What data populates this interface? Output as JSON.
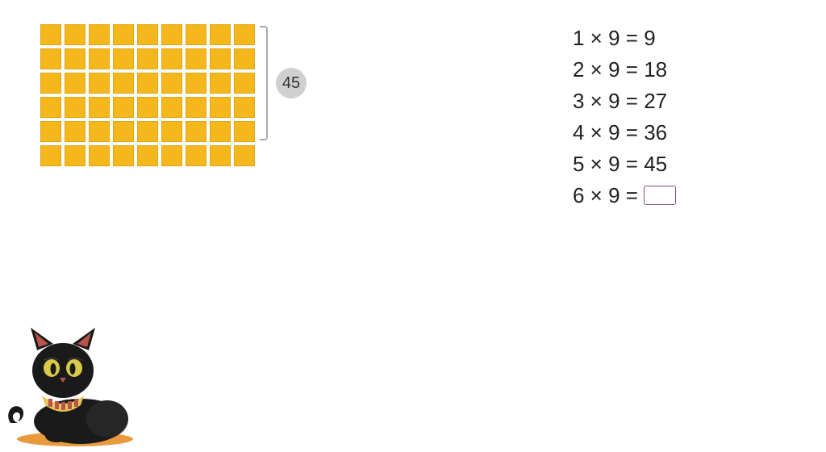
{
  "grid": {
    "rows": 6,
    "cols": 9
  },
  "badge_value": "45",
  "equations": [
    {
      "lhs": "1 × 9 =",
      "rhs": "9",
      "input": false
    },
    {
      "lhs": "2 × 9 =",
      "rhs": "18",
      "input": false
    },
    {
      "lhs": "3 × 9 =",
      "rhs": "27",
      "input": false
    },
    {
      "lhs": "4 × 9 =",
      "rhs": "36",
      "input": false
    },
    {
      "lhs": "5 × 9 =",
      "rhs": "45",
      "input": false
    },
    {
      "lhs": "6 × 9 =",
      "rhs": "",
      "input": true
    }
  ],
  "colors": {
    "square": "#f5b81c",
    "badge": "#d0d0d0",
    "input_border": "#8a4a7a"
  }
}
